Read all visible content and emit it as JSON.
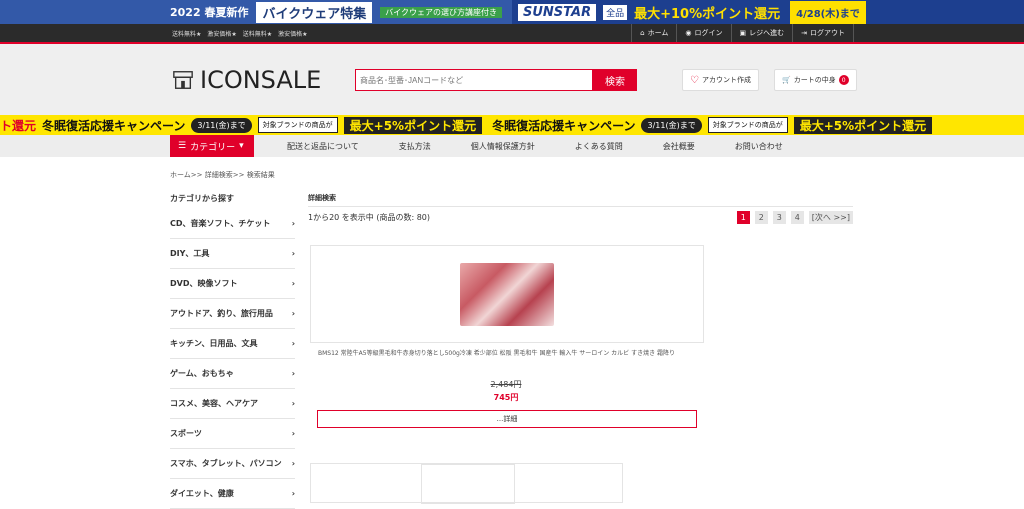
{
  "banner": {
    "season": "2022 春夏新作",
    "bike": "バイクウェア特集",
    "guide": "バイクウェアの選び方講座付き",
    "sunstar": "SUNSTAR",
    "zenpin": "全品",
    "points": "最大+10%ポイント還元",
    "date": "4/28(木)まで"
  },
  "navbar": {
    "features": [
      "送料無料★",
      "激安価格★",
      "送料無料★",
      "激安価格★"
    ],
    "links": [
      "ホーム",
      "ログイン",
      "レジへ進む",
      "ログアウト"
    ]
  },
  "header": {
    "logo": "ICONSALE",
    "search_placeholder": "商品名･型番･JANコードなど",
    "search_button": "検索",
    "account": "アカウント作成",
    "cart": "カートの中身",
    "cart_count": "0"
  },
  "promo": {
    "repeat": [
      {
        "left": "ト還元",
        "campaign": "冬眠復活応援キャンペーン",
        "date": "3/11(金)まで",
        "brand": "対象ブランドの商品が",
        "big": "最大+5%ポイント還元"
      },
      {
        "left": "",
        "campaign": "冬眠復活応援キャンペーン",
        "date": "3/11(金)まで",
        "brand": "対象ブランドの商品が",
        "big": "最大+5%ポイント還元"
      }
    ]
  },
  "catbar": {
    "category_button": "カテゴリー",
    "links": [
      "配送と返品について",
      "支払方法",
      "個人情報保護方針",
      "よくある質問",
      "会社概要",
      "お問い合わせ"
    ]
  },
  "breadcrumb": "ホーム>> 詳細検索>> 検索結果",
  "sidebar": {
    "title": "カテゴリから探す",
    "items": [
      "CD、音楽ソフト、チケット",
      "DIY、工具",
      "DVD、映像ソフト",
      "アウトドア、釣り、旅行用品",
      "キッチン、日用品、文具",
      "ゲーム、おもちゃ",
      "コスメ、美容、ヘアケア",
      "スポーツ",
      "スマホ、タブレット、パソコン",
      "ダイエット、健康"
    ]
  },
  "main": {
    "section_title": "詳細検索",
    "count_text": "1から20 を表示中 (商品の数: 80)",
    "pages": [
      "1",
      "2",
      "3",
      "4",
      "[次へ >>]"
    ]
  },
  "product": {
    "name": "BMS12 常陸牛A5等級黒毛和牛赤身切り落とし500g冷凍 希少部位 松阪 黒毛和牛 国産牛 輸入牛 サーロイン カルビ すき焼き 霜降り",
    "old_price": "2,484円",
    "price": "745円",
    "detail_button": "...詳細"
  }
}
